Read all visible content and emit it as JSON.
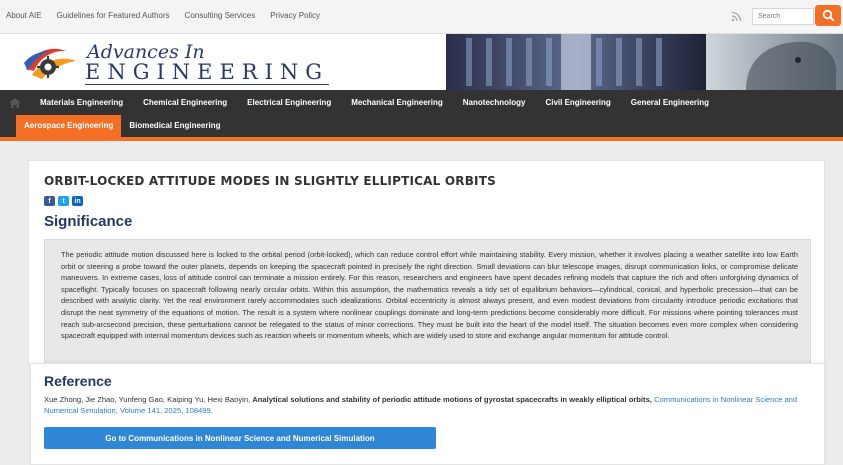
{
  "topbar": {
    "links": [
      "About AIE",
      "Guidelines for Featured Authors",
      "Consulting Services",
      "Privacy Policy"
    ],
    "search_placeholder": "Search"
  },
  "logo": {
    "line1": "Advances In",
    "line2": "ENGINEERING"
  },
  "nav": {
    "row1": [
      "Materials Engineering",
      "Chemical Engineering",
      "Electrical Engineering",
      "Mechanical Engineering",
      "Nanotechnology",
      "Civil Engineering",
      "General Engineering"
    ],
    "active": "Aerospace Engineering",
    "row2": [
      "Biomedical Engineering"
    ]
  },
  "article": {
    "title": "ORBIT-LOCKED ATTITUDE MODES IN SLIGHTLY ELLIPTICAL ORBITS",
    "share": [
      "f",
      "t",
      "in"
    ],
    "section_heading": "Significance",
    "significance": "The periodic attitude motion discussed here is locked to the orbital period (orbit-locked), which can reduce control effort while maintaining stability. Every mission, whether it involves placing a weather satellite into low Earth orbit or steering a probe toward the outer planets, depends on keeping the spacecraft pointed in precisely the right direction. Small deviations can blur telescope images, disrupt communication links, or compromise delicate maneuvers. In extreme cases, loss of attitude control can terminate a mission entirely. For this reason, researchers and engineers have spent decades refining models that capture the rich and often unforgiving dynamics of spaceflight. Typically focuses on spacecraft following nearly circular orbits. Within this assumption, the mathematics reveals a tidy set of equilibrium behaviors—cylindrical, conical, and hyperbolic precession—that can be described with analytic clarity. Yet the real environment rarely accommodates such idealizations. Orbital eccentricity is almost always present, and even modest deviations from circularity introduce periodic excitations that disrupt the neat symmetry of the equations of motion. The result is a system where nonlinear couplings dominate and long-term predictions become considerably more difficult. For missions where pointing tolerances must reach sub-arcsecond precision, these perturbations cannot be relegated to the status of minor corrections. They must be built into the heart of the model itself. The situation becomes even more complex when considering spacecraft equipped with internal momentum devices such as reaction wheels or momentum wheels, which are widely used to store and exchange angular momentum for attitude control."
  },
  "reference": {
    "heading": "Reference",
    "authors": "Xue Zhong, Jie Zhao, Yunfeng Gao, Kaiping Yu, Hexi Baoyin,",
    "paper_title": "Analytical solutions and stability of periodic attitude motions of gyrostat spacecrafts in weakly elliptical orbits,",
    "journal": "Communications in Nonlinear Science and Numerical Simulation, Volume 141, 2025, 108499.",
    "button": "Go to Communications in Nonlinear Science and Numerical Simulation"
  },
  "colors": {
    "accent": "#f36f25",
    "nav_bg": "#333333",
    "heading": "#23395d",
    "link": "#2b7fc7",
    "button": "#2e86d4"
  }
}
